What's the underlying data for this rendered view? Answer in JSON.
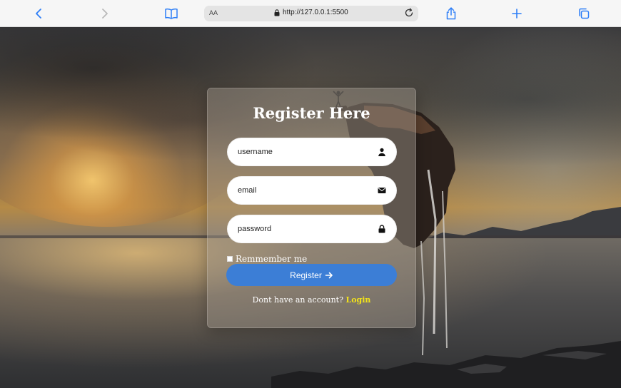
{
  "browser": {
    "reader_label": "AA",
    "url": "http://127.0.0.1:5500",
    "icons": {
      "back": "chevron-left-icon",
      "forward": "chevron-right-icon",
      "bookmarks": "book-icon",
      "lock": "lock-icon",
      "reload": "reload-icon",
      "share": "share-icon",
      "new_tab": "plus-icon",
      "tabs": "tabs-icon"
    },
    "accent_color": "#2d7ef7"
  },
  "form": {
    "title": "Register Here",
    "username": {
      "placeholder": "username",
      "icon": "user-icon"
    },
    "email": {
      "placeholder": "email",
      "icon": "envelope-icon"
    },
    "password": {
      "placeholder": "password",
      "icon": "lock-icon"
    },
    "remember_label": "Remmember me",
    "register_label": "Register",
    "footer_text": "Dont have an account?",
    "login_link": "Login",
    "button_color": "#3c7ed6",
    "link_color": "#f2e21a"
  }
}
